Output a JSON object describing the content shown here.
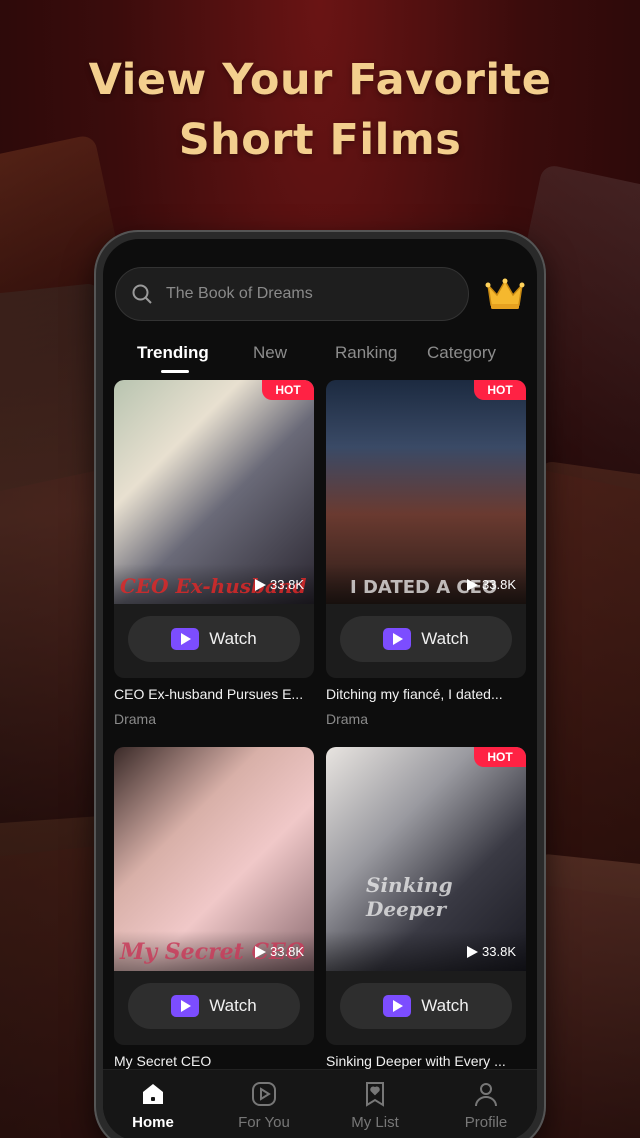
{
  "headline": {
    "line1": "View  Your Favorite",
    "line2": "Short Films"
  },
  "search": {
    "placeholder": "The Book of Dreams"
  },
  "tabs": [
    {
      "label": "Trending",
      "active": true
    },
    {
      "label": "New",
      "active": false
    },
    {
      "label": "Ranking",
      "active": false
    },
    {
      "label": "Category",
      "active": false
    }
  ],
  "cards": [
    {
      "title": "CEO Ex-husband Pursues E...",
      "genre": "Drama",
      "views": "33.8K",
      "hot": "HOT",
      "art": "CEO Ex-husband",
      "watch": "Watch"
    },
    {
      "title": "Ditching my fiancé, I dated...",
      "genre": "Drama",
      "views": "33.8K",
      "hot": "HOT",
      "art": "I DATED A CEO",
      "watch": "Watch"
    },
    {
      "title": "My Secret CEO",
      "genre": "",
      "views": "33.8K",
      "hot": "",
      "art": "My Secret CEO",
      "watch": "Watch"
    },
    {
      "title": "Sinking Deeper with Every ...",
      "genre": "",
      "views": "33.8K",
      "hot": "HOT",
      "art": "Sinking Deeper",
      "watch": "Watch"
    }
  ],
  "nav": [
    {
      "label": "Home",
      "icon": "home-icon",
      "active": true
    },
    {
      "label": "For You",
      "icon": "play-circle-icon",
      "active": false
    },
    {
      "label": "My List",
      "icon": "bookmark-heart-icon",
      "active": false
    },
    {
      "label": "Profile",
      "icon": "user-icon",
      "active": false
    }
  ],
  "colors": {
    "accent_gold": "#f3cf8e",
    "hot_red": "#ff2244",
    "watch_purple": "#7c4dff"
  }
}
